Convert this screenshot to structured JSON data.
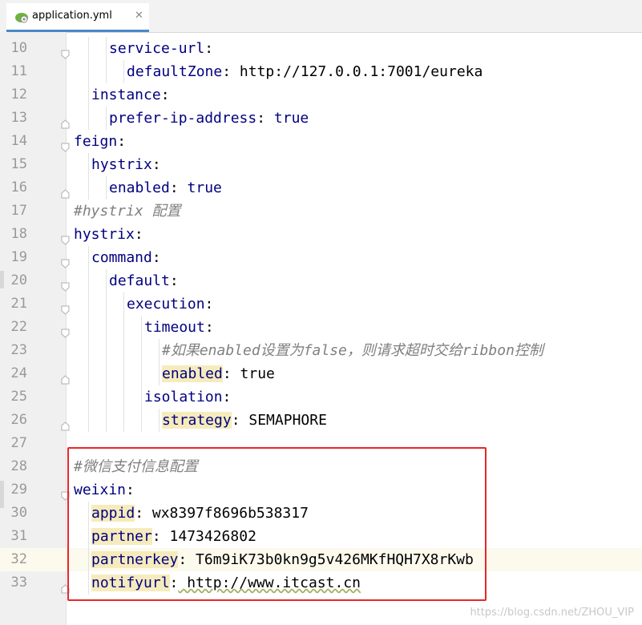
{
  "tab": {
    "filename": "application.yml",
    "close": "✕",
    "icon": "spring-leaf-icon"
  },
  "lines": [
    {
      "num": "10",
      "indent": 2,
      "key": "service-url",
      "sep": ":",
      "value": ""
    },
    {
      "num": "11",
      "indent": 3,
      "key": "defaultZone",
      "sep": ":",
      "value": " http://127.0.0.1:7001/eureka"
    },
    {
      "num": "12",
      "indent": 1,
      "key": "instance",
      "sep": ":",
      "value": ""
    },
    {
      "num": "13",
      "indent": 2,
      "key": "prefer-ip-address",
      "sep": ":",
      "value": " true"
    },
    {
      "num": "14",
      "indent": 0,
      "key": "feign",
      "sep": ":",
      "value": ""
    },
    {
      "num": "15",
      "indent": 1,
      "key": "hystrix",
      "sep": ":",
      "value": ""
    },
    {
      "num": "16",
      "indent": 2,
      "key": "enabled",
      "sep": ":",
      "value": " true"
    },
    {
      "num": "17",
      "indent": 0,
      "comment": "#hystrix 配置"
    },
    {
      "num": "18",
      "indent": 0,
      "key": "hystrix",
      "sep": ":",
      "value": ""
    },
    {
      "num": "19",
      "indent": 1,
      "key": "command",
      "sep": ":",
      "value": ""
    },
    {
      "num": "20",
      "indent": 2,
      "key": "default",
      "sep": ":",
      "value": ""
    },
    {
      "num": "21",
      "indent": 3,
      "key": "execution",
      "sep": ":",
      "value": ""
    },
    {
      "num": "22",
      "indent": 4,
      "key": "timeout",
      "sep": ":",
      "value": ""
    },
    {
      "num": "23",
      "indent": 5,
      "comment": "#如果enabled设置为false，则请求超时交给ribbon控制"
    },
    {
      "num": "24",
      "indent": 5,
      "key": "enabled",
      "sep": ":",
      "value": " true",
      "hl": true
    },
    {
      "num": "25",
      "indent": 4,
      "key": "isolation",
      "sep": ":",
      "value": ""
    },
    {
      "num": "26",
      "indent": 5,
      "key": "strategy",
      "sep": ":",
      "value": " SEMAPHORE",
      "hl": true
    },
    {
      "num": "27",
      "indent": 0,
      "key": "",
      "sep": "",
      "value": ""
    },
    {
      "num": "28",
      "indent": 0,
      "comment": "#微信支付信息配置"
    },
    {
      "num": "29",
      "indent": 0,
      "key": "weixin",
      "sep": ":",
      "value": ""
    },
    {
      "num": "30",
      "indent": 1,
      "key": "appid",
      "sep": ":",
      "value": " wx8397f8696b538317",
      "hl": true
    },
    {
      "num": "31",
      "indent": 1,
      "key": "partner",
      "sep": ":",
      "value": " 1473426802",
      "hl": true
    },
    {
      "num": "32",
      "indent": 1,
      "key": "partnerkey",
      "sep": ":",
      "value": " T6m9iK73b0kn9g5v426MKfHQH7X8rKwb",
      "hl": true,
      "current": true
    },
    {
      "num": "33",
      "indent": 1,
      "key": "notifyurl",
      "sep": ":",
      "value": " http://www.itcast.cn",
      "hl": true
    }
  ],
  "watermark": "https://blog.csdn.net/ZHOU_VIP",
  "colors": {
    "key": "#000080",
    "comment": "#808080",
    "highlight": "#f6ebbc",
    "box": "#e8262a"
  }
}
